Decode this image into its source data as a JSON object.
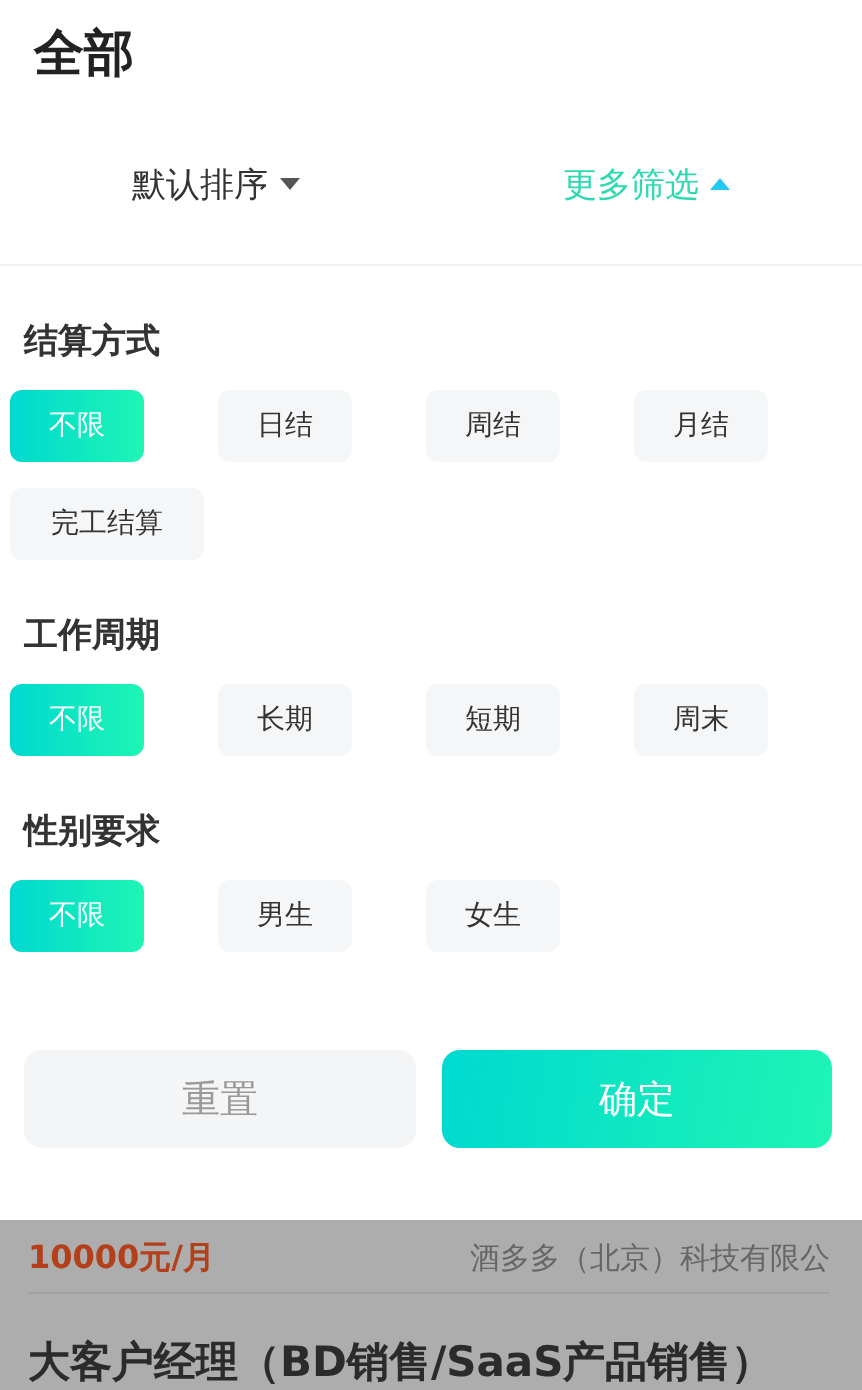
{
  "header": {
    "title": "全部"
  },
  "sort_bar": [
    {
      "label": "默认排序",
      "selected": false,
      "expanded": false
    },
    {
      "label": "更多筛选",
      "selected": true,
      "expanded": true
    }
  ],
  "filter_groups": [
    {
      "title": "结算方式",
      "options": [
        {
          "label": "不限",
          "selected": true
        },
        {
          "label": "日结",
          "selected": false
        },
        {
          "label": "周结",
          "selected": false
        },
        {
          "label": "月结",
          "selected": false
        },
        {
          "label": "完工结算",
          "selected": false
        }
      ]
    },
    {
      "title": "工作周期",
      "options": [
        {
          "label": "不限",
          "selected": true
        },
        {
          "label": "长期",
          "selected": false
        },
        {
          "label": "短期",
          "selected": false
        },
        {
          "label": "周末",
          "selected": false
        }
      ]
    },
    {
      "title": "性别要求",
      "options": [
        {
          "label": "不限",
          "selected": true
        },
        {
          "label": "男生",
          "selected": false
        },
        {
          "label": "女生",
          "selected": false
        }
      ]
    }
  ],
  "buttons": {
    "reset": "重置",
    "confirm": "确定"
  },
  "background_list": {
    "salary": "10000元/月",
    "company": "酒多多（北京）科技有限公",
    "job_title": "大客户经理（BD销售/SaaS产品销售）"
  }
}
